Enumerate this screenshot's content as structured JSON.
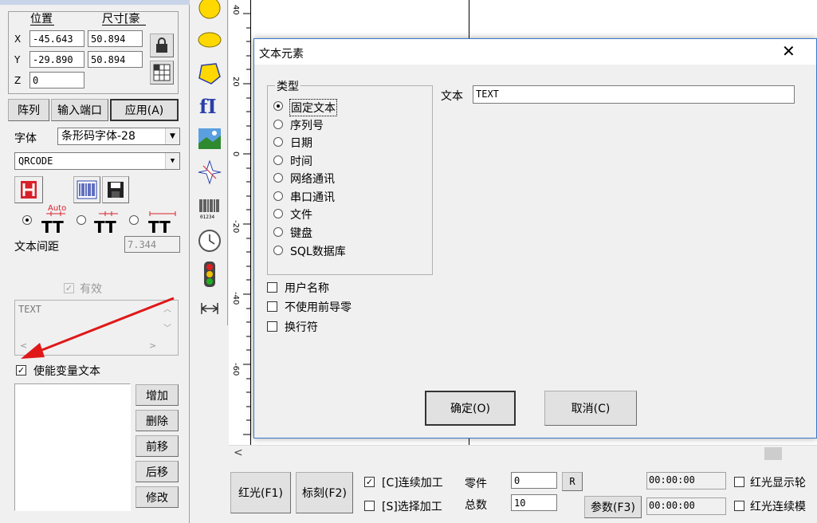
{
  "left_panel": {
    "position_header": "位置",
    "size_header": "尺寸[豪",
    "x_label": "X",
    "y_label": "Y",
    "z_label": "Z",
    "x_pos": "-45.643",
    "y_pos": "-29.890",
    "z_pos": "0",
    "x_size": "50.894",
    "y_size": "50.894",
    "array_button": "阵列",
    "input_port_button": "输入端口",
    "apply_button": "应用(A)",
    "font_label": "字体",
    "font_value": "条形码字体-28",
    "barcode_type": "QRCODE",
    "auto_label": "Auto",
    "text_spacing_label": "文本间距",
    "text_spacing_value": "7.344",
    "valid_label": "有效",
    "text_preview": "TEXT",
    "enable_variable_text": "使能变量文本",
    "add_button": "增加",
    "delete_button": "删除",
    "move_forward_button": "前移",
    "move_back_button": "后移",
    "modify_button": "修改"
  },
  "ruler": {
    "ticks": [
      "40",
      "20",
      "0",
      "-20",
      "-40",
      "-60"
    ]
  },
  "dialog": {
    "title": "文本元素",
    "type_group": "类型",
    "types": [
      "固定文本",
      "序列号",
      "日期",
      "时间",
      "网络通讯",
      "串口通讯",
      "文件",
      "键盘",
      "SQL数据库"
    ],
    "selected_type": "固定文本",
    "text_label": "文本",
    "text_value": "TEXT",
    "checkbox_username": "用户名称",
    "checkbox_no_leading_zero": "不使用前导零",
    "checkbox_newline": "换行符",
    "ok_button": "确定(O)",
    "cancel_button": "取消(C)"
  },
  "bottom_bar": {
    "red_light_button": "红光(F1)",
    "mark_button": "标刻(F2)",
    "continuous_label": "[C]连续加工",
    "select_label": "[S]选择加工",
    "parts_label": "零件",
    "total_label": "总数",
    "parts_value": "0",
    "total_value": "10",
    "reset_button": "R",
    "params_button": "参数(F3)",
    "time1": "00:00:00",
    "time2": "00:00:00",
    "red_show_outline": "红光显示轮",
    "red_continuous": "红光连续模"
  }
}
